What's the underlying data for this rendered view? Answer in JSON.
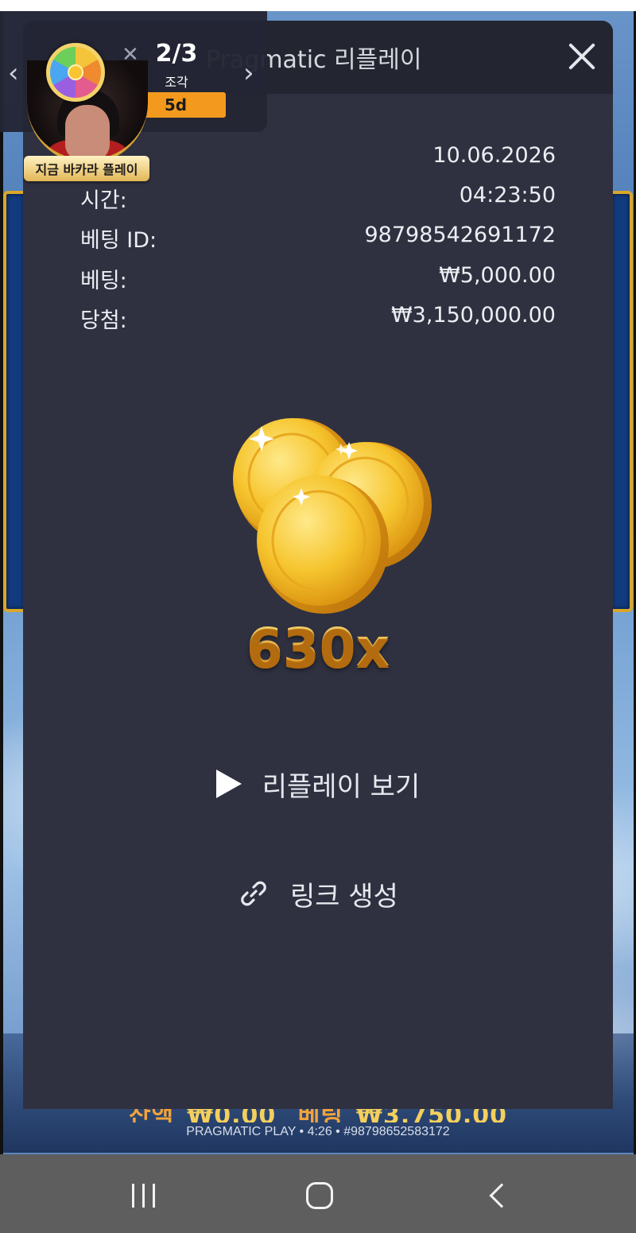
{
  "game": {
    "balance_label": "잔액",
    "balance_value": "₩0.00",
    "bet_label": "베팅",
    "bet_value": "₩3,750.00",
    "footer": "PRAGMATIC PLAY • 4:26 • #98798652583172"
  },
  "replay": {
    "title": "Pragmatic 리플레이",
    "date": "10.06.2026",
    "rows": [
      {
        "label": "시간:",
        "value": "04:23:50"
      },
      {
        "label": "베팅 ID:",
        "value": "98798542691172"
      },
      {
        "label": "베팅:",
        "value": "₩5,000.00"
      },
      {
        "label": "당첨:",
        "value": "₩3,150,000.00"
      }
    ],
    "multiplier": "630x",
    "watch_label": "리플레이 보기",
    "link_label": "링크 생성"
  },
  "promo": {
    "count": "2/3",
    "count_label": "조각",
    "time_left": "5d",
    "live_label": "지금 바카라 플레이"
  },
  "icons": {
    "close": "close-icon",
    "play": "play-icon",
    "link": "link-icon",
    "wheel": "prize-wheel-icon"
  },
  "colors": {
    "modal_bg": "#2f3140",
    "header_bg": "#232531",
    "multiplier": "#f5b82e",
    "badge_orange": "#f39a1e",
    "navbar": "#5e5e5e"
  }
}
